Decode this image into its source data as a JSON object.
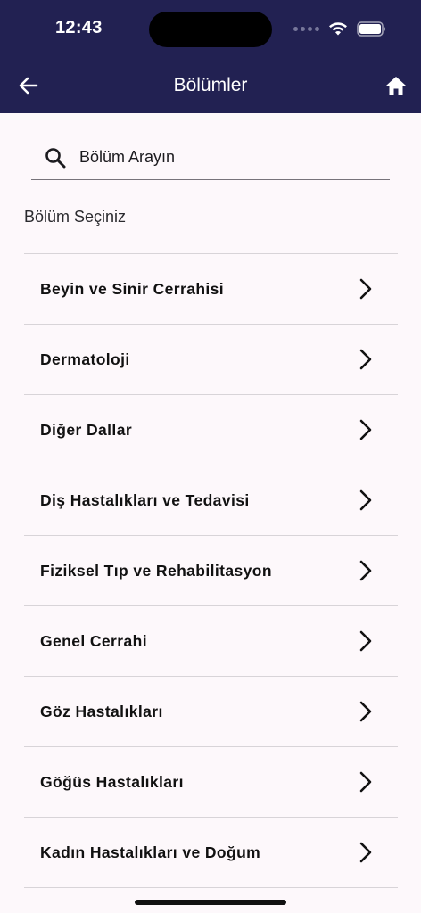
{
  "status_bar": {
    "time": "12:43"
  },
  "nav": {
    "title": "Bölümler",
    "back_icon": "arrow-left-icon",
    "home_icon": "home-icon"
  },
  "search": {
    "placeholder": "Bölüm Arayın",
    "value": ""
  },
  "section_label": "Bölüm Seçiniz",
  "departments": [
    {
      "label": "Beyin ve Sinir Cerrahisi"
    },
    {
      "label": "Dermatoloji"
    },
    {
      "label": "Diğer Dallar"
    },
    {
      "label": "Diş Hastalıkları ve Tedavisi"
    },
    {
      "label": "Fiziksel Tıp ve Rehabilitasyon"
    },
    {
      "label": "Genel Cerrahi"
    },
    {
      "label": "Göz Hastalıkları"
    },
    {
      "label": "Göğüs Hastalıkları"
    },
    {
      "label": "Kadın Hastalıkları ve Doğum"
    }
  ],
  "colors": {
    "header_bg": "#222152",
    "page_bg": "#fdf8fb",
    "divider": "#d8d4d8"
  }
}
